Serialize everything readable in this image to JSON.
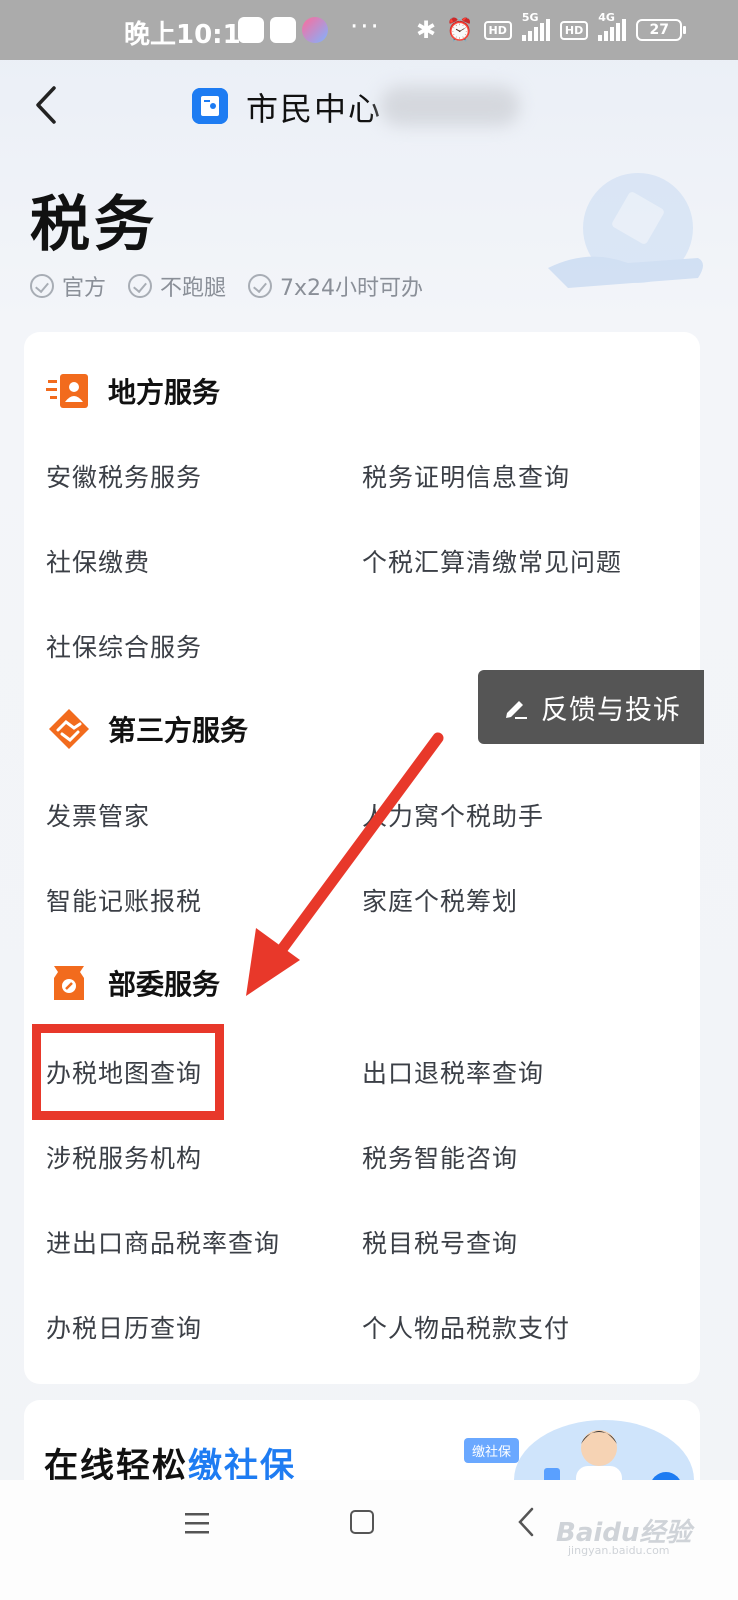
{
  "status_bar": {
    "time": "晚上10:12",
    "network1": "5G",
    "network2": "4G",
    "hd": "HD",
    "battery": "27",
    "more": "···"
  },
  "nav": {
    "title": "市民中心"
  },
  "hero": {
    "title": "税务",
    "tags": [
      "官方",
      "不跑腿",
      "7x24小时可办"
    ]
  },
  "sections": [
    {
      "title": "地方服务",
      "icon": "local-service-icon",
      "items": [
        "安徽税务服务",
        "税务证明信息查询",
        "社保缴费",
        "个税汇算清缴常见问题",
        "社保综合服务"
      ]
    },
    {
      "title": "第三方服务",
      "icon": "third-party-icon",
      "items": [
        "发票管家",
        "人力窝个税助手",
        "智能记账报税",
        "家庭个税筹划"
      ]
    },
    {
      "title": "部委服务",
      "icon": "ministry-service-icon",
      "items": [
        "办税地图查询",
        "出口退税率查询",
        "涉税服务机构",
        "税务智能咨询",
        "进出口商品税率查询",
        "税目税号查询",
        "办税日历查询",
        "个人物品税款支付"
      ]
    }
  ],
  "feedback": {
    "label": "反馈与投诉"
  },
  "promo": {
    "title_plain": "在线轻松",
    "title_highlight": "缴社保",
    "badge": "缴社保"
  },
  "watermark": {
    "text": "Baidu经验",
    "sub": "jingyan.baidu.com"
  },
  "colors": {
    "accent": "#1e7cf2",
    "orange": "#f26b1d",
    "highlight_red": "#e8382a"
  }
}
